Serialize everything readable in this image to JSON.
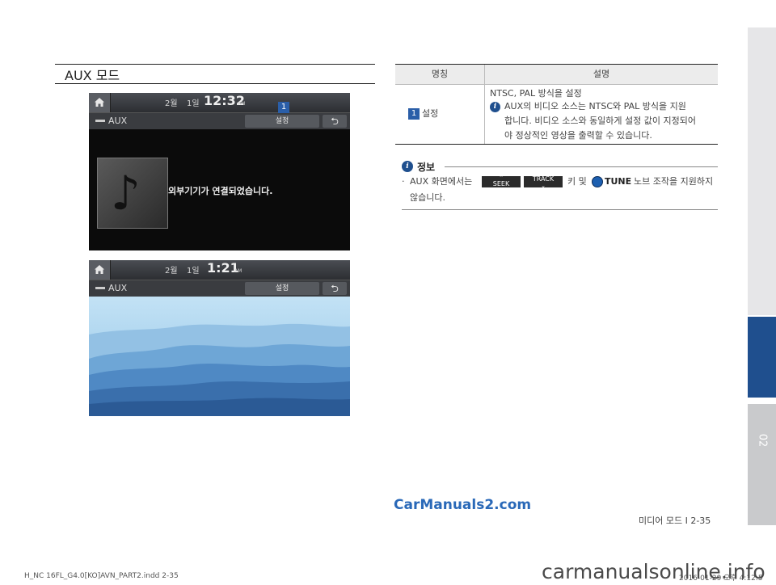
{
  "section_title": "AUX 모드",
  "chapter_tab": "02",
  "screen1": {
    "month": "2월",
    "day": "1일",
    "time": "12:32",
    "ampm": "AM",
    "source_label": "AUX",
    "settings_label": "설정",
    "back_symbol": "⮌",
    "connection_message": "외부기기가 연결되었습니다.",
    "callout": "1"
  },
  "screen2": {
    "month": "2월",
    "day": "1일",
    "time": "1:21",
    "ampm": "AM",
    "source_label": "AUX",
    "settings_label": "설정",
    "back_symbol": "⮌"
  },
  "table": {
    "headers": [
      "명칭",
      "설명"
    ],
    "rows": [
      {
        "num": "1",
        "name": "설정",
        "desc_line1": "NTSC, PAL 방식을 설정",
        "info_l1": "AUX의 비디오 소스는 NTSC와 PAL 방식을 지원",
        "info_l2": "합니다. 비디오 소스와 동일하게 설정 값이 지정되어",
        "info_l3": "야 정상적인 영상을 출력할 수 있습니다."
      }
    ]
  },
  "info_box": {
    "heading": "정보",
    "bullet": "·",
    "text_before_keys": "AUX 화면에서는",
    "seek_key": "SEEK",
    "track_key": "TRACK",
    "text_mid": "키 및",
    "tune_label": "TUNE",
    "text_after": "노브 조작을 지원하지",
    "text_line2": "않습니다."
  },
  "watermark": "CarManuals2.com",
  "page_footer": "미디어 모드 I 2-35",
  "slug_left": "H_NC 16FL_G4.0[KO]AVN_PART2.indd   2-35",
  "slug_right": "2016-01-29   오후 4:12:5",
  "bottom_mark": "carmanualsonline.info",
  "colors": {
    "accent_blue": "#1f4f8e",
    "watermark_blue": "#2a69b8"
  }
}
